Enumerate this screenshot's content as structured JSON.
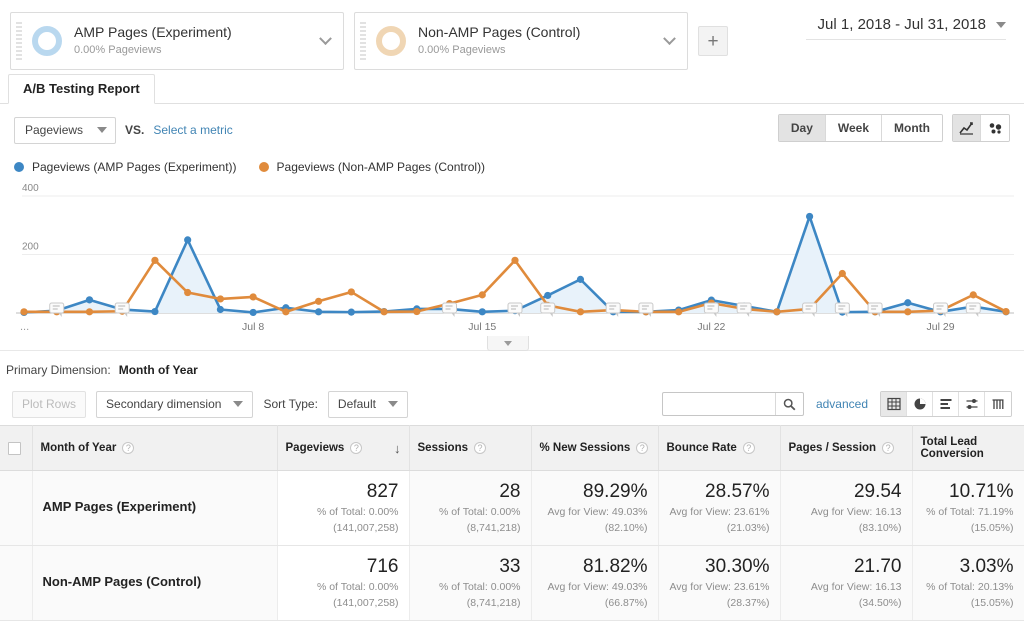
{
  "segments": [
    {
      "title": "AMP Pages (Experiment)",
      "subtitle": "0.00% Pageviews",
      "color": "#b9d8ef"
    },
    {
      "title": "Non-AMP Pages (Control)",
      "subtitle": "0.00% Pageviews",
      "color": "#f0d6b4"
    }
  ],
  "add_segment_label": "+",
  "date_range": {
    "label": "Jul 1, 2018 - Jul 31, 2018"
  },
  "tab": {
    "label": "A/B Testing Report"
  },
  "metric_row": {
    "metric_selected": "Pageviews",
    "vs_label": "VS.",
    "select_metric_link": "Select a metric"
  },
  "chart_controls": {
    "granularity": [
      "Day",
      "Week",
      "Month"
    ],
    "granularity_active": "Day",
    "view_icons": [
      "line-chart-icon",
      "scatter-plot-icon"
    ],
    "view_active": "line-chart-icon"
  },
  "primary_dimension": {
    "label": "Primary Dimension:",
    "value": "Month of Year"
  },
  "table_controls": {
    "plot_rows": "Plot Rows",
    "secondary_dimension": "Secondary dimension",
    "sort_type_label": "Sort Type:",
    "sort_type_value": "Default",
    "search_placeholder": "",
    "search_value": "",
    "advanced_link": "advanced",
    "view_icons": [
      "table-view-icon",
      "pie-view-icon",
      "bar-view-icon",
      "performance-view-icon",
      "pivot-view-icon"
    ],
    "view_active": "table-view-icon"
  },
  "table": {
    "columns": [
      {
        "label": "Month of Year",
        "help": true,
        "sorted": false
      },
      {
        "label": "Pageviews",
        "help": true,
        "sorted": true,
        "sort_dir": "↓"
      },
      {
        "label": "Sessions",
        "help": true,
        "sorted": false
      },
      {
        "label": "% New Sessions",
        "help": true,
        "sorted": false
      },
      {
        "label": "Bounce Rate",
        "help": true,
        "sorted": false
      },
      {
        "label": "Pages / Session",
        "help": true,
        "sorted": false
      },
      {
        "label": "Total Lead Conversion",
        "help": false,
        "sorted": false
      }
    ],
    "rows": [
      {
        "name": "AMP Pages (Experiment)",
        "cells": [
          {
            "value": "827",
            "sub1": "% of Total: 0.00%",
            "sub2": "(141,007,258)"
          },
          {
            "value": "28",
            "sub1": "% of Total: 0.00%",
            "sub2": "(8,741,218)"
          },
          {
            "value": "89.29%",
            "sub1": "Avg for View: 49.03%",
            "sub2": "(82.10%)"
          },
          {
            "value": "28.57%",
            "sub1": "Avg for View: 23.61%",
            "sub2": "(21.03%)"
          },
          {
            "value": "29.54",
            "sub1": "Avg for View: 16.13",
            "sub2": "(83.10%)"
          },
          {
            "value": "10.71%",
            "sub1": "% of Total: 71.19%",
            "sub2": "(15.05%)"
          }
        ]
      },
      {
        "name": "Non-AMP Pages (Control)",
        "cells": [
          {
            "value": "716",
            "sub1": "% of Total: 0.00%",
            "sub2": "(141,007,258)"
          },
          {
            "value": "33",
            "sub1": "% of Total: 0.00%",
            "sub2": "(8,741,218)"
          },
          {
            "value": "81.82%",
            "sub1": "Avg for View: 49.03%",
            "sub2": "(66.87%)"
          },
          {
            "value": "30.30%",
            "sub1": "Avg for View: 23.61%",
            "sub2": "(28.37%)"
          },
          {
            "value": "21.70",
            "sub1": "Avg for View: 16.13",
            "sub2": "(34.50%)"
          },
          {
            "value": "3.03%",
            "sub1": "% of Total: 20.13%",
            "sub2": "(15.05%)"
          }
        ]
      }
    ]
  },
  "chart_data": {
    "type": "line",
    "title": "",
    "xlabel": "",
    "ylabel": "Pageviews",
    "ylim": [
      0,
      400
    ],
    "yticks": [
      200,
      400
    ],
    "grid": true,
    "legend_position": "top-left",
    "x_axis_leading_label": "...",
    "x": [
      "Jul 1",
      "Jul 2",
      "Jul 3",
      "Jul 4",
      "Jul 5",
      "Jul 6",
      "Jul 7",
      "Jul 8",
      "Jul 9",
      "Jul 10",
      "Jul 11",
      "Jul 12",
      "Jul 13",
      "Jul 14",
      "Jul 15",
      "Jul 16",
      "Jul 17",
      "Jul 18",
      "Jul 19",
      "Jul 20",
      "Jul 21",
      "Jul 22",
      "Jul 23",
      "Jul 24",
      "Jul 25",
      "Jul 26",
      "Jul 27",
      "Jul 28",
      "Jul 29",
      "Jul 30",
      "Jul 31"
    ],
    "xticks": [
      "Jul 8",
      "Jul 15",
      "Jul 22",
      "Jul 29"
    ],
    "series": [
      {
        "name": "Pageviews (AMP Pages (Experiment))",
        "color": "#3d87c4",
        "values": [
          2,
          8,
          45,
          12,
          5,
          250,
          12,
          2,
          18,
          4,
          3,
          5,
          14,
          14,
          4,
          8,
          60,
          115,
          4,
          4,
          10,
          44,
          24,
          4,
          330,
          3,
          4,
          35,
          4,
          22,
          4
        ]
      },
      {
        "name": "Pageviews (Non-AMP Pages (Control))",
        "color": "#e08b3c",
        "values": [
          4,
          4,
          4,
          6,
          180,
          70,
          48,
          55,
          4,
          40,
          72,
          4,
          5,
          32,
          62,
          180,
          26,
          4,
          10,
          4,
          4,
          34,
          14,
          4,
          14,
          135,
          4,
          4,
          8,
          62,
          5,
          4
        ]
      }
    ],
    "annotations_count": 14
  }
}
